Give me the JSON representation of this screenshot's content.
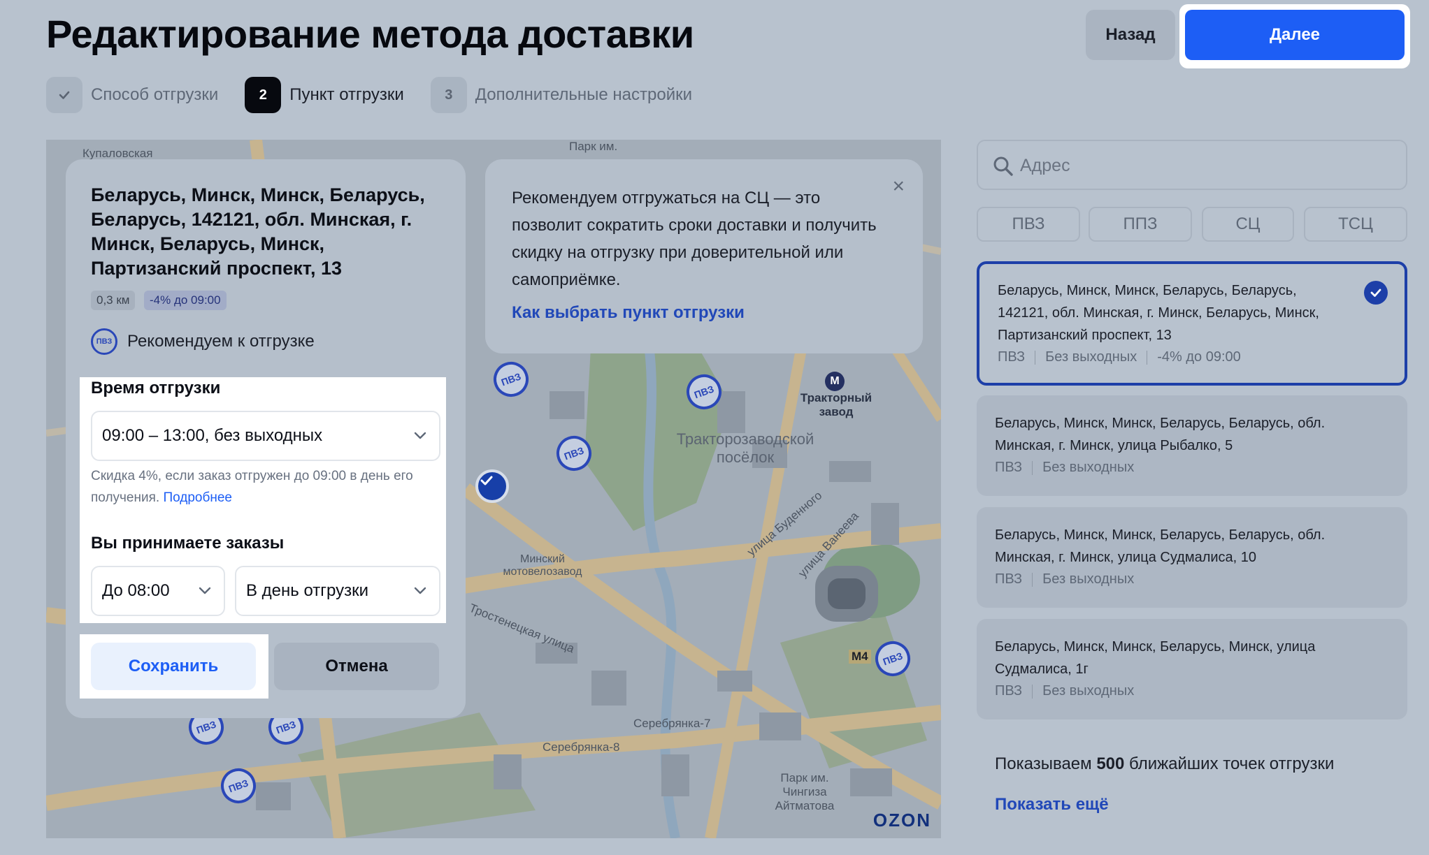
{
  "header": {
    "title": "Редактирование метода доставки",
    "back_label": "Назад",
    "next_label": "Далее"
  },
  "steps": [
    {
      "num": "✓",
      "label": "Способ отгрузки",
      "state": "done"
    },
    {
      "num": "2",
      "label": "Пункт отгрузки",
      "state": "active"
    },
    {
      "num": "3",
      "label": "Дополнительные настройки",
      "state": "todo"
    }
  ],
  "map": {
    "labels": {
      "kupalovskaya": "Купаловская",
      "park": "Парк им.",
      "traktorny": "Тракторный завод",
      "poselok": "Тракторозаводской посёлок",
      "motovelo": "Минский мотовелозавод",
      "budennogo": "улица Буденного",
      "vaneeva": "улица Ванеева",
      "trostenetskaya": "Тростенецкая улица",
      "serebryanka7": "Серебрянка-7",
      "serebryanka8": "Серебрянка-8",
      "park_aitmatova": "Парк им. Чингиза Айтматова",
      "m4": "M4",
      "metro": "М"
    },
    "pin_label": "ПВЗ",
    "logo": "OZON"
  },
  "detail": {
    "address": "Беларусь, Минск, Минск, Беларусь, Беларусь, 142121, обл. Минская, г. Минск, Беларусь, Минск, Партизанский проспект, 13",
    "distance": "0,3 км",
    "discount": "-4% до 09:00",
    "recommend_badge": "ПВЗ",
    "recommend_text": "Рекомендуем к отгрузке",
    "time_label": "Время отгрузки",
    "time_value": "09:00 – 13:00, без выходных",
    "hint_text": "Скидка 4%, если заказ отгружен до 09:00 в день его получения. ",
    "hint_link": "Подробнее",
    "accept_label": "Вы принимаете заказы",
    "accept_time": "До 08:00",
    "accept_day": "В день отгрузки",
    "save_label": "Сохранить",
    "cancel_label": "Отмена"
  },
  "tip": {
    "text": "Рекомендуем отгружаться на СЦ — это позволит сократить сроки доставки и получить скидку на отгрузку при доверительной или самоприёмке.",
    "link": "Как выбрать пункт отгрузки",
    "close": "×"
  },
  "sidebar": {
    "search_placeholder": "Адрес",
    "filters": [
      "ПВЗ",
      "ППЗ",
      "СЦ",
      "ТСЦ"
    ],
    "points": [
      {
        "address": "Беларусь, Минск, Минск, Беларусь, Беларусь, 142121, обл. Минская, г. Минск, Беларусь, Минск, Партизанский проспект, 13",
        "type": "ПВЗ",
        "schedule": "Без выходных",
        "discount": "-4% до 09:00"
      },
      {
        "address": "Беларусь, Минск, Минск, Беларусь, Беларусь, обл. Минская, г. Минск, улица Рыбалко, 5",
        "type": "ПВЗ",
        "schedule": "Без выходных"
      },
      {
        "address": "Беларусь, Минск, Минск, Беларусь, Беларусь, обл. Минская, г. Минск, улица Судмалиса, 10",
        "type": "ПВЗ",
        "schedule": "Без выходных"
      },
      {
        "address": "Беларусь, Минск, Минск, Беларусь, Минск, улица Судмалиса, 1г",
        "type": "ПВЗ",
        "schedule": "Без выходных"
      }
    ],
    "showing_prefix": "Показываем ",
    "showing_count": "500",
    "showing_suffix": " ближайших точек отгрузки",
    "show_more": "Показать ещё"
  },
  "colors": {
    "accent": "#1d5ef5",
    "pin": "#2a47b8",
    "overlay_bg": "#b8c2ce"
  }
}
